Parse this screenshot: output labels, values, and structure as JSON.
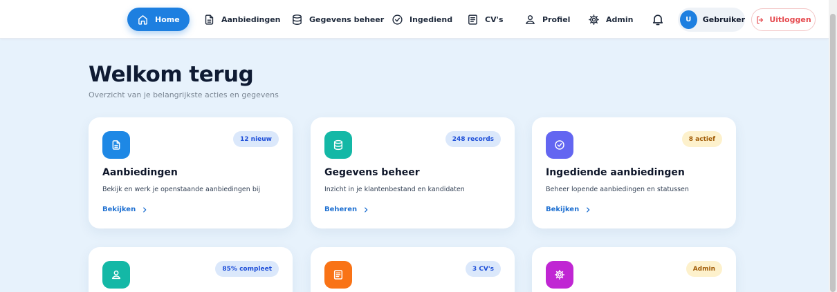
{
  "nav": {
    "items": [
      {
        "label": "Home",
        "icon": "home-icon",
        "active": true
      },
      {
        "label": "Aanbiedingen",
        "icon": "document-icon",
        "active": false
      },
      {
        "label": "Gegevens beheer",
        "icon": "database-icon",
        "active": false
      },
      {
        "label": "Ingediend",
        "icon": "check-circle-icon",
        "active": false
      },
      {
        "label": "CV's",
        "icon": "list-document-icon",
        "active": false
      },
      {
        "label": "Profiel",
        "icon": "user-icon",
        "active": false
      },
      {
        "label": "Admin",
        "icon": "gear-icon",
        "active": false
      }
    ],
    "notifications_icon": "bell-icon",
    "user": {
      "initial": "U",
      "name": "Gebruiker"
    },
    "logout_label": "Uitloggen",
    "logout_icon": "logout-icon"
  },
  "page": {
    "title": "Welkom terug",
    "subtitle": "Overzicht van je belangrijkste acties en gegevens"
  },
  "cards": [
    {
      "title": "Aanbiedingen",
      "description": "Bekijk en werk je openstaande aanbiedingen bij",
      "badge": "12 nieuw",
      "link": "Bekijken",
      "icon": "document-icon",
      "color": "#1e88e5"
    },
    {
      "title": "Gegevens beheer",
      "description": "Inzicht in je klantenbestand en kandidaten",
      "badge": "248 records",
      "link": "Beheren",
      "icon": "database-icon",
      "color": "#14b8a6"
    },
    {
      "title": "Ingediende aanbiedingen",
      "description": "Beheer lopende aanbiedingen en statussen",
      "badge": "8 actief",
      "link": "Bekijken",
      "icon": "check-circle-icon",
      "color": "#6366f1"
    },
    {
      "title": "",
      "description": "",
      "badge": "85% compleet",
      "link": "",
      "icon": "user-icon",
      "color": "#14b8a6"
    },
    {
      "title": "",
      "description": "",
      "badge": "3 CV's",
      "link": "",
      "icon": "list-document-icon",
      "color": "#f97316"
    },
    {
      "title": "",
      "description": "",
      "badge": "Admin",
      "link": "",
      "icon": "gear-icon",
      "color": "#c026d3"
    }
  ],
  "colors": {
    "accent": "#1d7fe0",
    "background": "#e7f2fc",
    "logout": "#e5484d",
    "badge_blue_bg": "#dbe8fb",
    "badge_amber_bg": "#fdf1cc"
  }
}
